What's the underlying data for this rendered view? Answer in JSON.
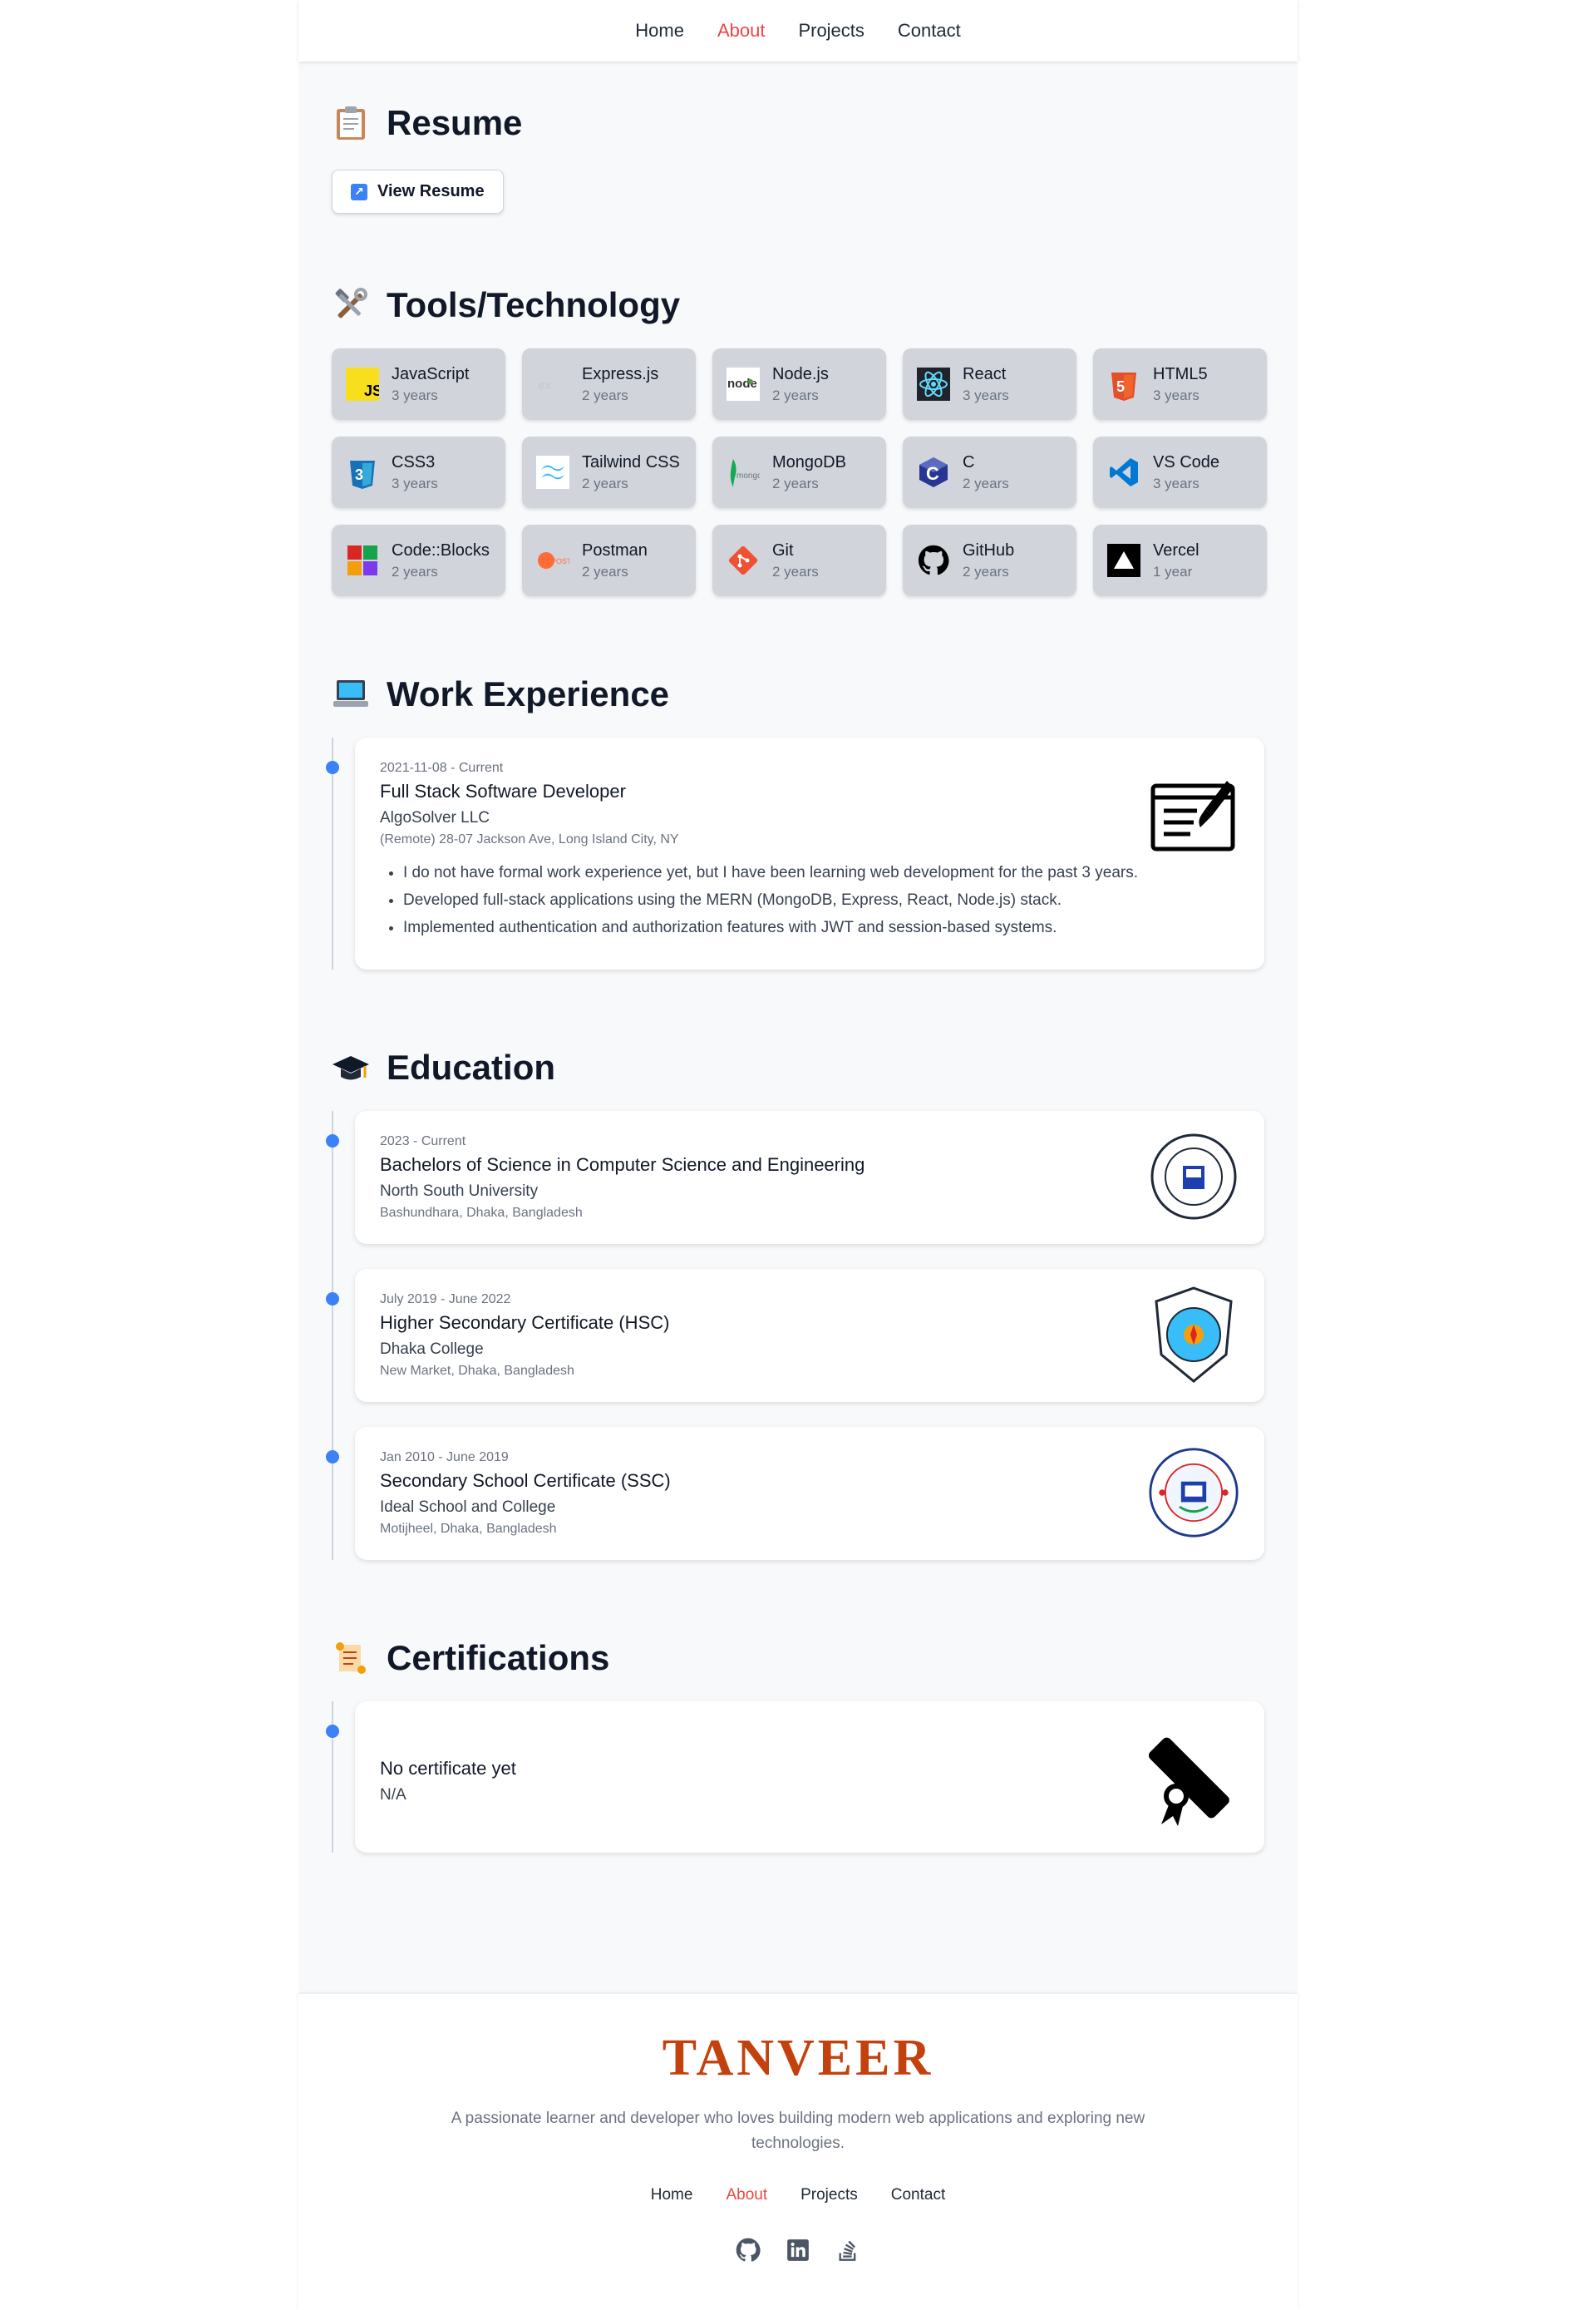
{
  "nav": {
    "items": [
      "Home",
      "About",
      "Projects",
      "Contact"
    ],
    "active": "About"
  },
  "resume": {
    "heading": "Resume",
    "button_label": "View Resume"
  },
  "tools": {
    "heading": "Tools/Technology",
    "items": [
      {
        "name": "JavaScript",
        "years": "3 years",
        "icon": "javascript-icon"
      },
      {
        "name": "Express.js",
        "years": "2 years",
        "icon": "express-icon"
      },
      {
        "name": "Node.js",
        "years": "2 years",
        "icon": "nodejs-icon"
      },
      {
        "name": "React",
        "years": "3 years",
        "icon": "react-icon"
      },
      {
        "name": "HTML5",
        "years": "3 years",
        "icon": "html5-icon"
      },
      {
        "name": "CSS3",
        "years": "3 years",
        "icon": "css3-icon"
      },
      {
        "name": "Tailwind CSS",
        "years": "2 years",
        "icon": "tailwind-icon"
      },
      {
        "name": "MongoDB",
        "years": "2 years",
        "icon": "mongodb-icon"
      },
      {
        "name": "C",
        "years": "2 years",
        "icon": "c-icon"
      },
      {
        "name": "VS Code",
        "years": "3 years",
        "icon": "vscode-icon"
      },
      {
        "name": "Code::Blocks",
        "years": "2 years",
        "icon": "codeblocks-icon"
      },
      {
        "name": "Postman",
        "years": "2 years",
        "icon": "postman-icon"
      },
      {
        "name": "Git",
        "years": "2 years",
        "icon": "git-icon"
      },
      {
        "name": "GitHub",
        "years": "2 years",
        "icon": "github-icon"
      },
      {
        "name": "Vercel",
        "years": "1 year",
        "icon": "vercel-icon"
      }
    ]
  },
  "work": {
    "heading": "Work Experience",
    "items": [
      {
        "date": "2021-11-08 - Current",
        "title": "Full Stack Software Developer",
        "org": "AlgoSolver LLC",
        "loc": "(Remote) 28-07 Jackson Ave, Long Island City, NY",
        "bullets": [
          "I do not have formal work experience yet, but I have been learning web development for the past 3 years.",
          "Developed full-stack applications using the MERN (MongoDB, Express, React, Node.js) stack.",
          "Implemented authentication and authorization features with JWT and session-based systems."
        ]
      }
    ]
  },
  "education": {
    "heading": "Education",
    "items": [
      {
        "date": "2023 - Current",
        "title": "Bachelors of Science in Computer Science and Engineering",
        "org": "North South University",
        "loc": "Bashundhara, Dhaka, Bangladesh"
      },
      {
        "date": "July 2019 - June 2022",
        "title": "Higher Secondary Certificate (HSC)",
        "org": "Dhaka College",
        "loc": "New Market, Dhaka, Bangladesh"
      },
      {
        "date": "Jan 2010 - June 2019",
        "title": "Secondary School Certificate (SSC)",
        "org": "Ideal School and College",
        "loc": "Motijheel, Dhaka, Bangladesh"
      }
    ]
  },
  "certs": {
    "heading": "Certifications",
    "items": [
      {
        "title": "No certificate yet",
        "org": "N/A"
      }
    ]
  },
  "footer": {
    "brand": "TANVEER",
    "tagline": "A passionate learner and developer who loves building modern web applications and exploring new technologies.",
    "links": [
      "Home",
      "About",
      "Projects",
      "Contact"
    ],
    "socials": [
      "github-icon",
      "linkedin-icon",
      "stackoverflow-icon"
    ]
  },
  "colors": {
    "accent_active": "#ef4444",
    "timeline_dot": "#3b82f6",
    "brand": "#c2410c"
  }
}
